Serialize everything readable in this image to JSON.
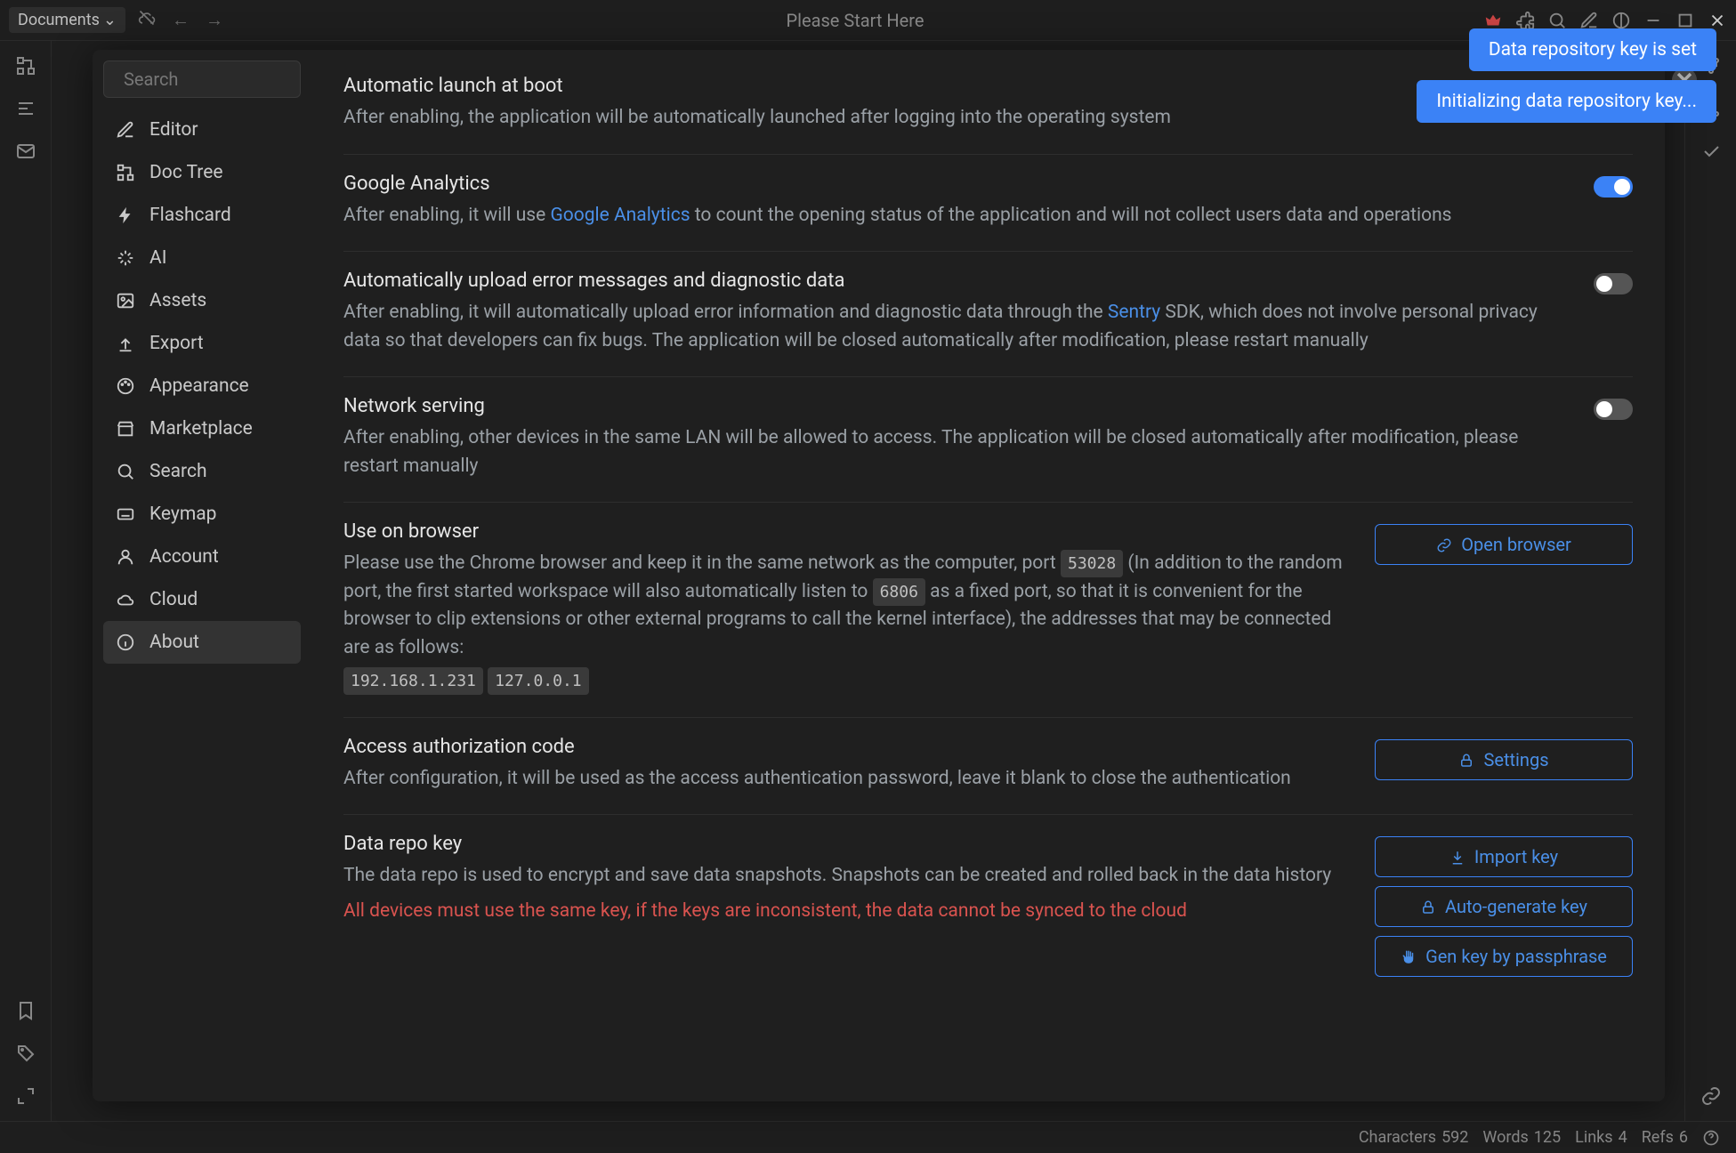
{
  "titlebar": {
    "workspace": "Documents",
    "title": "Please Start Here"
  },
  "toasts": [
    "Data repository key is set",
    "Initializing data repository key..."
  ],
  "search": {
    "placeholder": "Search"
  },
  "sidebar": {
    "items": [
      {
        "label": "Editor",
        "icon": "pencil"
      },
      {
        "label": "Doc Tree",
        "icon": "tree"
      },
      {
        "label": "Flashcard",
        "icon": "bolt"
      },
      {
        "label": "AI",
        "icon": "sparkle"
      },
      {
        "label": "Assets",
        "icon": "image"
      },
      {
        "label": "Export",
        "icon": "upload"
      },
      {
        "label": "Appearance",
        "icon": "palette"
      },
      {
        "label": "Marketplace",
        "icon": "store"
      },
      {
        "label": "Search",
        "icon": "search"
      },
      {
        "label": "Keymap",
        "icon": "keyboard"
      },
      {
        "label": "Account",
        "icon": "person"
      },
      {
        "label": "Cloud",
        "icon": "cloud"
      },
      {
        "label": "About",
        "icon": "info"
      }
    ]
  },
  "settings": {
    "auto_launch": {
      "title": "Automatic launch at boot",
      "desc": "After enabling, the application will be automatically launched after logging into the operating system"
    },
    "ga": {
      "title": "Google Analytics",
      "desc_pre": "After enabling, it will use ",
      "link": "Google Analytics",
      "desc_post": " to count the opening status of the application and will not collect users data and operations",
      "toggle": true
    },
    "diag": {
      "title": "Automatically upload error messages and diagnostic data",
      "desc_pre": "After enabling, it will automatically upload error information and diagnostic data through the ",
      "link": "Sentry",
      "desc_post": " SDK, which does not involve personal privacy data so that developers can fix bugs. The application will be closed automatically after modification, please restart manually",
      "toggle": false
    },
    "network": {
      "title": "Network serving",
      "desc": "After enabling, other devices in the same LAN will be allowed to access. The application will be closed automatically after modification, please restart manually",
      "toggle": false
    },
    "browser": {
      "title": "Use on browser",
      "desc_pre": "Please use the Chrome browser and keep it in the same network as the computer, port ",
      "port1": "53028",
      "desc_mid": " (In addition to the random port, the first started workspace will also automatically listen to ",
      "port2": "6806",
      "desc_post": " as a fixed port, so that it is convenient for the browser to clip extensions or other external programs to call the kernel interface), the addresses that may be connected are as follows:",
      "addr1": "192.168.1.231",
      "addr2": "127.0.0.1",
      "button": "Open browser"
    },
    "auth": {
      "title": "Access authorization code",
      "desc": "After configuration, it will be used as the access authentication password, leave it blank to close the authentication",
      "button": "Settings"
    },
    "repo": {
      "title": "Data repo key",
      "desc": "The data repo is used to encrypt and save data snapshots. Snapshots can be created and rolled back in the data history",
      "warning": "All devices must use the same key, if the keys are inconsistent, the data cannot be synced to the cloud",
      "btn_import": "Import key",
      "btn_auto": "Auto-generate key",
      "btn_pass": "Gen key by passphrase"
    }
  },
  "statusbar": {
    "chars_label": "Characters",
    "chars": "592",
    "words_label": "Words",
    "words": "125",
    "links_label": "Links",
    "links": "4",
    "refs_label": "Refs",
    "refs": "6"
  }
}
